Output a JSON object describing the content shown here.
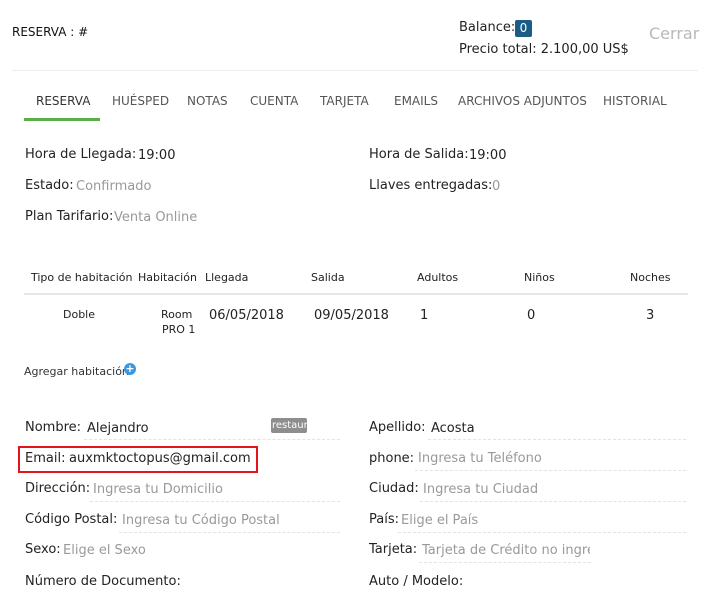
{
  "header": {
    "title": "RESERVA : #",
    "balance_label": "Balance:",
    "balance_value": "0",
    "total_label": "Precio total: 2.100,00 US$",
    "close_label": "Cerrar"
  },
  "tabs": [
    {
      "label": "RESERVA"
    },
    {
      "label": "HUÉSPED"
    },
    {
      "label": "NOTAS"
    },
    {
      "label": "CUENTA"
    },
    {
      "label": "TARJETA"
    },
    {
      "label": "EMAILS"
    },
    {
      "label": "ARCHIVOS ADJUNTOS"
    },
    {
      "label": "HISTORIAL"
    }
  ],
  "reservation": {
    "arrival_time_label": "Hora de Llegada:",
    "arrival_time": "19:00",
    "departure_time_label": "Hora de Salida:",
    "departure_time": "19:00",
    "status_label": "Estado:",
    "status": "Confirmado",
    "keys_label": "Llaves entregadas:",
    "keys": "0",
    "rate_plan_label": "Plan Tarifario:",
    "rate_plan": "Venta Online"
  },
  "rooms_table": {
    "headers": [
      "Tipo de habitación",
      "Habitación",
      "Llegada",
      "Salida",
      "Adultos",
      "Niños",
      "Noches"
    ],
    "rows": [
      {
        "type": "Doble",
        "room_line1": "Room",
        "room_line2": "PRO 1",
        "arrival": "06/05/2018",
        "departure": "09/05/2018",
        "adults": "1",
        "children": "0",
        "nights": "3"
      }
    ]
  },
  "add_room_label": "Agregar habitación",
  "guest": {
    "name_label": "Nombre:",
    "name": "Alejandro",
    "tag": "restaurante",
    "surname_label": "Apellido:",
    "surname": "Acosta",
    "email_label": "Email:",
    "email": "auxmktoctopus@gmail.com",
    "phone_label": "phone:",
    "phone_placeholder": "Ingresa tu Teléfono",
    "address_label": "Dirección:",
    "address_placeholder": "Ingresa tu Domicilio",
    "city_label": "Ciudad:",
    "city_placeholder": "Ingresa tu Ciudad",
    "postal_label": "Código Postal:",
    "postal_placeholder": "Ingresa tu Código Postal",
    "country_label": "País:",
    "country_placeholder": "Elige el País",
    "sex_label": "Sexo:",
    "sex_placeholder": "Elige el Sexo",
    "card_label": "Tarjeta:",
    "card_placeholder": "Tarjeta de Crédito no ingresada",
    "document_label": "Número de Documento:",
    "car_label": "Auto / Modelo:"
  }
}
